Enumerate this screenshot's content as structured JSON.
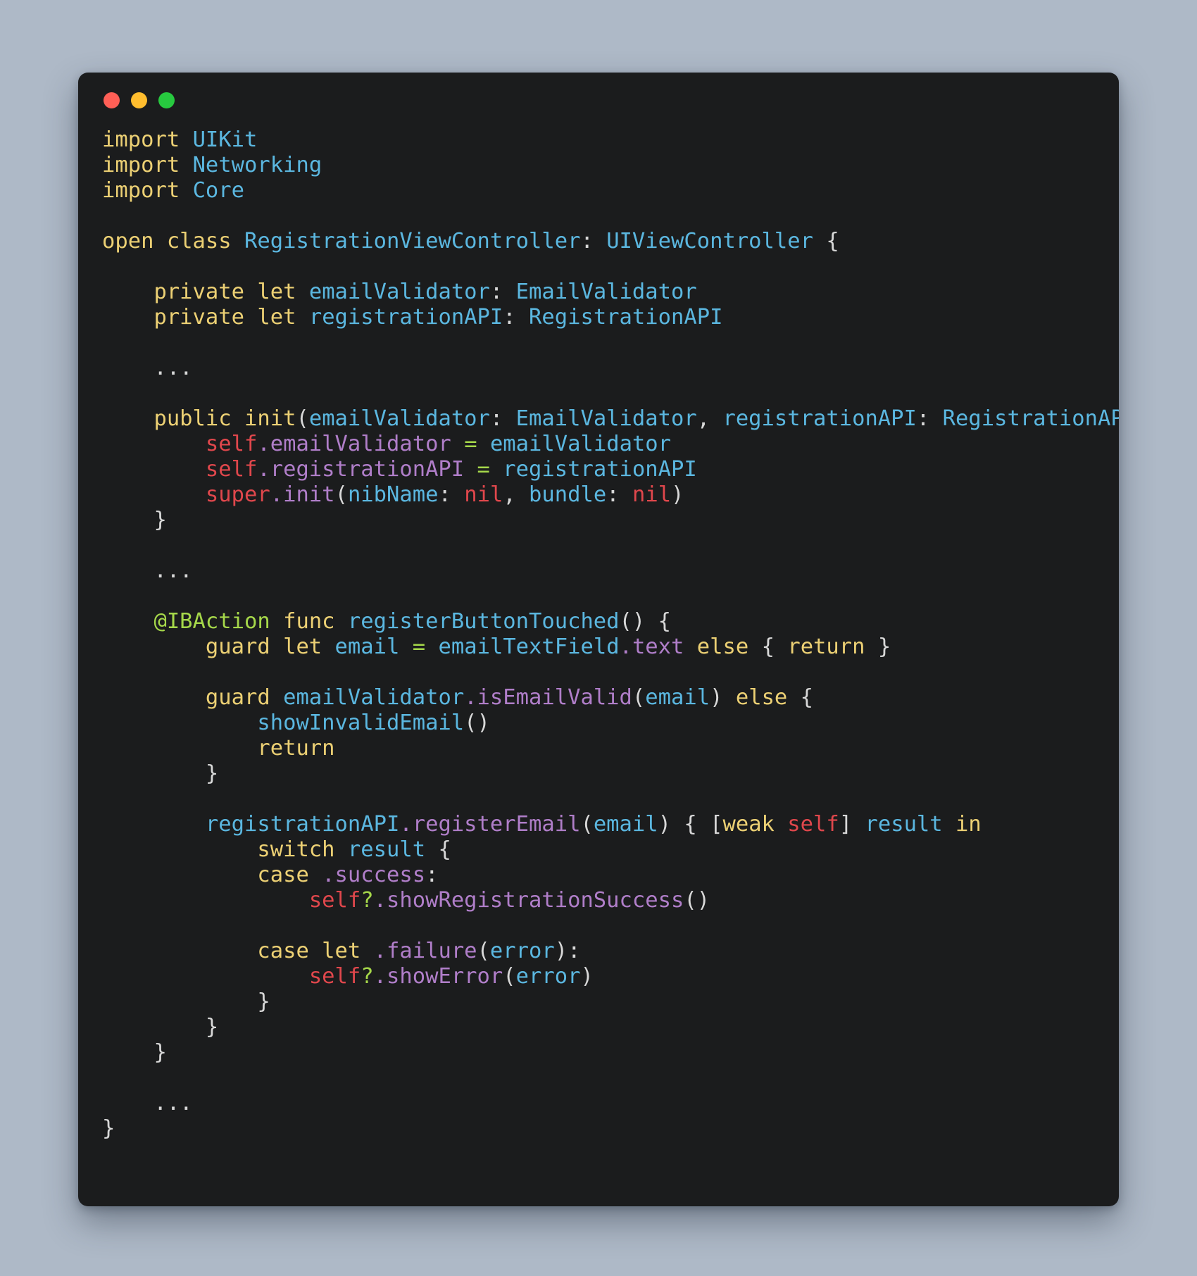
{
  "window": {
    "traffic_lights": [
      {
        "name": "close",
        "color": "#ff5f56"
      },
      {
        "name": "minimize",
        "color": "#ffbd2e"
      },
      {
        "name": "maximize",
        "color": "#27c93f"
      }
    ],
    "background": "#1b1c1d",
    "page_background": "#aeb9c7"
  },
  "theme": {
    "keyword": "#ecd074",
    "type": "#5bb7e0",
    "identifier": "#5bb7e0",
    "property": "#b07ec9",
    "self_keyword": "#e0474c",
    "operator": "#a6d84a",
    "attribute": "#a6d84a",
    "punctuation": "#d8d8d8",
    "plain": "#d8d8d8"
  },
  "code": {
    "language": "swift",
    "lines": [
      [
        {
          "t": "kw",
          "v": "import"
        },
        {
          "t": "plain",
          "v": " "
        },
        {
          "t": "type",
          "v": "UIKit"
        }
      ],
      [
        {
          "t": "kw",
          "v": "import"
        },
        {
          "t": "plain",
          "v": " "
        },
        {
          "t": "type",
          "v": "Networking"
        }
      ],
      [
        {
          "t": "kw",
          "v": "import"
        },
        {
          "t": "plain",
          "v": " "
        },
        {
          "t": "type",
          "v": "Core"
        }
      ],
      [],
      [
        {
          "t": "kw",
          "v": "open class"
        },
        {
          "t": "plain",
          "v": " "
        },
        {
          "t": "type",
          "v": "RegistrationViewController"
        },
        {
          "t": "punc",
          "v": ": "
        },
        {
          "t": "type",
          "v": "UIViewController"
        },
        {
          "t": "punc",
          "v": " {"
        }
      ],
      [],
      [
        {
          "t": "plain",
          "v": "    "
        },
        {
          "t": "kw",
          "v": "private let"
        },
        {
          "t": "plain",
          "v": " "
        },
        {
          "t": "id",
          "v": "emailValidator"
        },
        {
          "t": "punc",
          "v": ": "
        },
        {
          "t": "type",
          "v": "EmailValidator"
        }
      ],
      [
        {
          "t": "plain",
          "v": "    "
        },
        {
          "t": "kw",
          "v": "private let"
        },
        {
          "t": "plain",
          "v": " "
        },
        {
          "t": "id",
          "v": "registrationAPI"
        },
        {
          "t": "punc",
          "v": ": "
        },
        {
          "t": "type",
          "v": "RegistrationAPI"
        }
      ],
      [],
      [
        {
          "t": "plain",
          "v": "    "
        },
        {
          "t": "dots",
          "v": "..."
        }
      ],
      [],
      [
        {
          "t": "plain",
          "v": "    "
        },
        {
          "t": "kw",
          "v": "public init"
        },
        {
          "t": "punc",
          "v": "("
        },
        {
          "t": "id",
          "v": "emailValidator"
        },
        {
          "t": "punc",
          "v": ": "
        },
        {
          "t": "type",
          "v": "EmailValidator"
        },
        {
          "t": "punc",
          "v": ", "
        },
        {
          "t": "id",
          "v": "registrationAPI"
        },
        {
          "t": "punc",
          "v": ": "
        },
        {
          "t": "type",
          "v": "RegistrationAPI"
        },
        {
          "t": "punc",
          "v": ") {"
        }
      ],
      [
        {
          "t": "plain",
          "v": "        "
        },
        {
          "t": "self",
          "v": "self"
        },
        {
          "t": "prop",
          "v": ".emailValidator"
        },
        {
          "t": "plain",
          "v": " "
        },
        {
          "t": "op",
          "v": "="
        },
        {
          "t": "plain",
          "v": " "
        },
        {
          "t": "id",
          "v": "emailValidator"
        }
      ],
      [
        {
          "t": "plain",
          "v": "        "
        },
        {
          "t": "self",
          "v": "self"
        },
        {
          "t": "prop",
          "v": ".registrationAPI"
        },
        {
          "t": "plain",
          "v": " "
        },
        {
          "t": "op",
          "v": "="
        },
        {
          "t": "plain",
          "v": " "
        },
        {
          "t": "id",
          "v": "registrationAPI"
        }
      ],
      [
        {
          "t": "plain",
          "v": "        "
        },
        {
          "t": "self",
          "v": "super"
        },
        {
          "t": "prop",
          "v": ".init"
        },
        {
          "t": "punc",
          "v": "("
        },
        {
          "t": "id",
          "v": "nibName"
        },
        {
          "t": "punc",
          "v": ": "
        },
        {
          "t": "self",
          "v": "nil"
        },
        {
          "t": "punc",
          "v": ", "
        },
        {
          "t": "id",
          "v": "bundle"
        },
        {
          "t": "punc",
          "v": ": "
        },
        {
          "t": "self",
          "v": "nil"
        },
        {
          "t": "punc",
          "v": ")"
        }
      ],
      [
        {
          "t": "plain",
          "v": "    "
        },
        {
          "t": "punc",
          "v": "}"
        }
      ],
      [],
      [
        {
          "t": "plain",
          "v": "    "
        },
        {
          "t": "dots",
          "v": "..."
        }
      ],
      [],
      [
        {
          "t": "plain",
          "v": "    "
        },
        {
          "t": "attr",
          "v": "@IBAction"
        },
        {
          "t": "plain",
          "v": " "
        },
        {
          "t": "kw",
          "v": "func"
        },
        {
          "t": "plain",
          "v": " "
        },
        {
          "t": "id",
          "v": "registerButtonTouched"
        },
        {
          "t": "punc",
          "v": "() {"
        }
      ],
      [
        {
          "t": "plain",
          "v": "        "
        },
        {
          "t": "kw",
          "v": "guard let"
        },
        {
          "t": "plain",
          "v": " "
        },
        {
          "t": "id",
          "v": "email"
        },
        {
          "t": "plain",
          "v": " "
        },
        {
          "t": "op",
          "v": "="
        },
        {
          "t": "plain",
          "v": " "
        },
        {
          "t": "id",
          "v": "emailTextField"
        },
        {
          "t": "prop",
          "v": ".text"
        },
        {
          "t": "plain",
          "v": " "
        },
        {
          "t": "kw",
          "v": "else"
        },
        {
          "t": "punc",
          "v": " { "
        },
        {
          "t": "kw",
          "v": "return"
        },
        {
          "t": "punc",
          "v": " }"
        }
      ],
      [],
      [
        {
          "t": "plain",
          "v": "        "
        },
        {
          "t": "kw",
          "v": "guard"
        },
        {
          "t": "plain",
          "v": " "
        },
        {
          "t": "id",
          "v": "emailValidator"
        },
        {
          "t": "prop",
          "v": ".isEmailValid"
        },
        {
          "t": "punc",
          "v": "("
        },
        {
          "t": "id",
          "v": "email"
        },
        {
          "t": "punc",
          "v": ") "
        },
        {
          "t": "kw",
          "v": "else"
        },
        {
          "t": "punc",
          "v": " {"
        }
      ],
      [
        {
          "t": "plain",
          "v": "            "
        },
        {
          "t": "id",
          "v": "showInvalidEmail"
        },
        {
          "t": "punc",
          "v": "()"
        }
      ],
      [
        {
          "t": "plain",
          "v": "            "
        },
        {
          "t": "kw",
          "v": "return"
        }
      ],
      [
        {
          "t": "plain",
          "v": "        "
        },
        {
          "t": "punc",
          "v": "}"
        }
      ],
      [],
      [
        {
          "t": "plain",
          "v": "        "
        },
        {
          "t": "id",
          "v": "registrationAPI"
        },
        {
          "t": "prop",
          "v": ".registerEmail"
        },
        {
          "t": "punc",
          "v": "("
        },
        {
          "t": "id",
          "v": "email"
        },
        {
          "t": "punc",
          "v": ") { ["
        },
        {
          "t": "kw",
          "v": "weak"
        },
        {
          "t": "plain",
          "v": " "
        },
        {
          "t": "self",
          "v": "self"
        },
        {
          "t": "punc",
          "v": "] "
        },
        {
          "t": "id",
          "v": "result"
        },
        {
          "t": "plain",
          "v": " "
        },
        {
          "t": "kw",
          "v": "in"
        }
      ],
      [
        {
          "t": "plain",
          "v": "            "
        },
        {
          "t": "kw",
          "v": "switch"
        },
        {
          "t": "plain",
          "v": " "
        },
        {
          "t": "id",
          "v": "result"
        },
        {
          "t": "punc",
          "v": " {"
        }
      ],
      [
        {
          "t": "plain",
          "v": "            "
        },
        {
          "t": "kw",
          "v": "case"
        },
        {
          "t": "plain",
          "v": " "
        },
        {
          "t": "prop",
          "v": ".success"
        },
        {
          "t": "punc",
          "v": ":"
        }
      ],
      [
        {
          "t": "plain",
          "v": "                "
        },
        {
          "t": "self",
          "v": "self"
        },
        {
          "t": "op",
          "v": "?"
        },
        {
          "t": "prop",
          "v": ".showRegistrationSuccess"
        },
        {
          "t": "punc",
          "v": "()"
        }
      ],
      [],
      [
        {
          "t": "plain",
          "v": "            "
        },
        {
          "t": "kw",
          "v": "case let"
        },
        {
          "t": "plain",
          "v": " "
        },
        {
          "t": "prop",
          "v": ".failure"
        },
        {
          "t": "punc",
          "v": "("
        },
        {
          "t": "id",
          "v": "error"
        },
        {
          "t": "punc",
          "v": "):"
        }
      ],
      [
        {
          "t": "plain",
          "v": "                "
        },
        {
          "t": "self",
          "v": "self"
        },
        {
          "t": "op",
          "v": "?"
        },
        {
          "t": "prop",
          "v": ".showError"
        },
        {
          "t": "punc",
          "v": "("
        },
        {
          "t": "id",
          "v": "error"
        },
        {
          "t": "punc",
          "v": ")"
        }
      ],
      [
        {
          "t": "plain",
          "v": "            "
        },
        {
          "t": "punc",
          "v": "}"
        }
      ],
      [
        {
          "t": "plain",
          "v": "        "
        },
        {
          "t": "punc",
          "v": "}"
        }
      ],
      [
        {
          "t": "plain",
          "v": "    "
        },
        {
          "t": "punc",
          "v": "}"
        }
      ],
      [],
      [
        {
          "t": "plain",
          "v": "    "
        },
        {
          "t": "dots",
          "v": "..."
        }
      ],
      [
        {
          "t": "punc",
          "v": "}"
        }
      ]
    ]
  }
}
